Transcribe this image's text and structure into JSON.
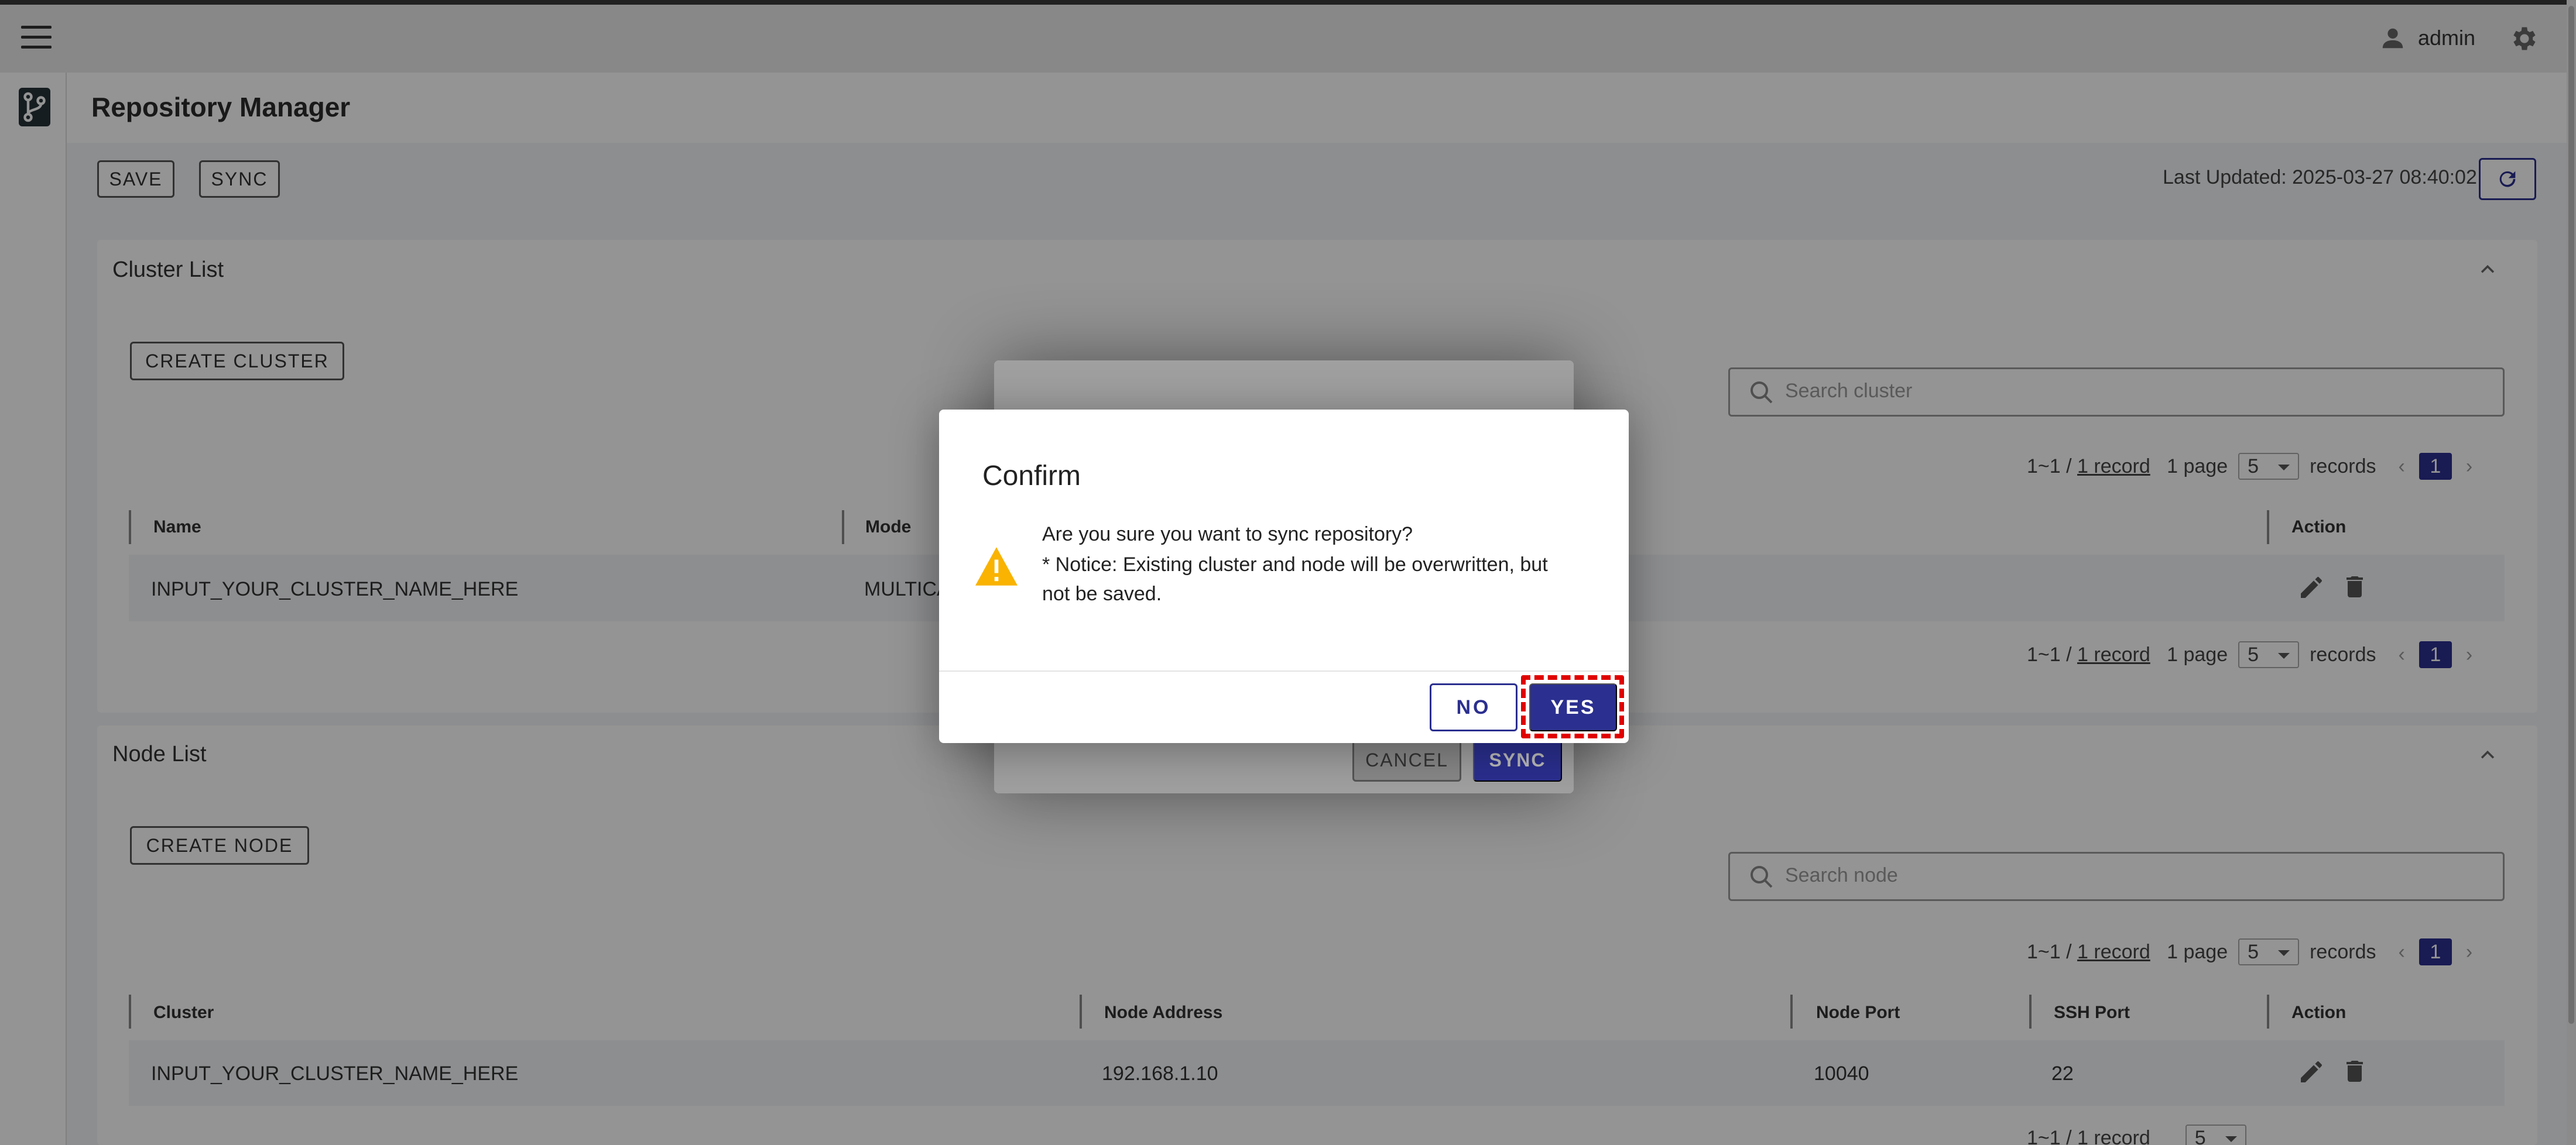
{
  "topbar": {
    "username": "admin"
  },
  "page": {
    "title": "Repository Manager"
  },
  "toolbar": {
    "save_label": "SAVE",
    "sync_label": "SYNC",
    "last_updated": "Last Updated: 2025-03-27 08:40:02"
  },
  "cluster_list": {
    "title": "Cluster List",
    "create_label": "CREATE CLUSTER",
    "search_placeholder": "Search cluster",
    "pager": {
      "range": "1~1 / ",
      "record_link": "1 record",
      "pages": "1 page",
      "per_page": "5",
      "records_label": "records",
      "current": "1"
    },
    "columns": [
      "Name",
      "Mode",
      "Action"
    ],
    "rows": [
      {
        "name": "INPUT_YOUR_CLUSTER_NAME_HERE",
        "mode": "MULTICA"
      }
    ]
  },
  "node_list": {
    "title": "Node List",
    "create_label": "CREATE NODE",
    "search_placeholder": "Search node",
    "pager": {
      "range": "1~1 / ",
      "record_link": "1 record",
      "pages": "1 page",
      "per_page": "5",
      "records_label": "records",
      "current": "1"
    },
    "columns": [
      "Cluster",
      "Node Address",
      "Node Port",
      "SSH Port",
      "Action"
    ],
    "rows": [
      {
        "cluster": "INPUT_YOUR_CLUSTER_NAME_HERE",
        "address": "192.168.1.10",
        "node_port": "10040",
        "ssh_port": "22"
      }
    ],
    "footer_pager": {
      "range": "1~1 / ",
      "record_link": "1 record",
      "per_page": "5"
    }
  },
  "behind_dialog": {
    "cancel_label": "CANCEL",
    "sync_label": "SYNC"
  },
  "confirm_dialog": {
    "title": "Confirm",
    "line1": "Are you sure you want to sync repository?",
    "line2": "* Notice: Existing cluster and node will be overwritten, but",
    "line3": "not be saved.",
    "no_label": "NO",
    "yes_label": "YES"
  },
  "colors": {
    "primary": "#2b2f8f",
    "warning": "#f9b300",
    "highlight": "#e00000"
  }
}
